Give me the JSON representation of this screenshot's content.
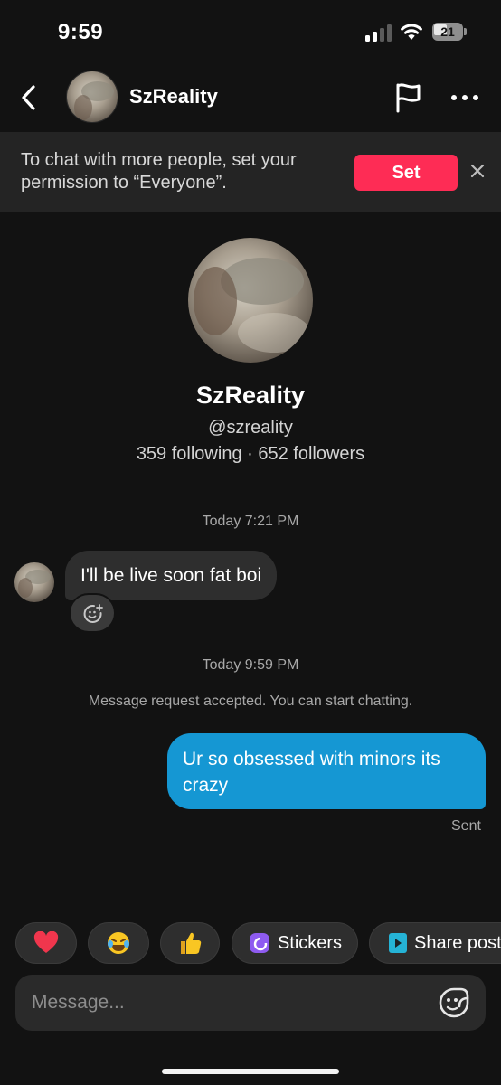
{
  "status_bar": {
    "time": "9:59",
    "battery": "21"
  },
  "header": {
    "name": "SzReality"
  },
  "banner": {
    "text": "To chat with more people, set your permission to “Everyone”.",
    "button": "Set"
  },
  "profile": {
    "name": "SzReality",
    "handle": "@szreality",
    "stats": "359 following · 652 followers"
  },
  "chat": {
    "timestamp_1": "Today 7:21 PM",
    "incoming_message": "I'll be live soon fat boi",
    "timestamp_2": "Today 9:59 PM",
    "notice": "Message request accepted. You can start chatting.",
    "outgoing_message": "Ur so obsessed with minors its crazy",
    "delivery_status": "Sent"
  },
  "quick_actions": {
    "items": [
      {
        "icon": "heart-icon",
        "label": ""
      },
      {
        "icon": "laughing-emoji-icon",
        "label": ""
      },
      {
        "icon": "thumbs-up-icon",
        "label": ""
      },
      {
        "icon": "stickers-icon",
        "label": "Stickers"
      },
      {
        "icon": "share-post-icon",
        "label": "Share post"
      }
    ]
  },
  "composer": {
    "placeholder": "Message..."
  },
  "colors": {
    "background": "#121212",
    "accent": "#fe2c55",
    "outgoing_bubble": "#1597d3",
    "incoming_bubble": "#2e2e2e"
  }
}
